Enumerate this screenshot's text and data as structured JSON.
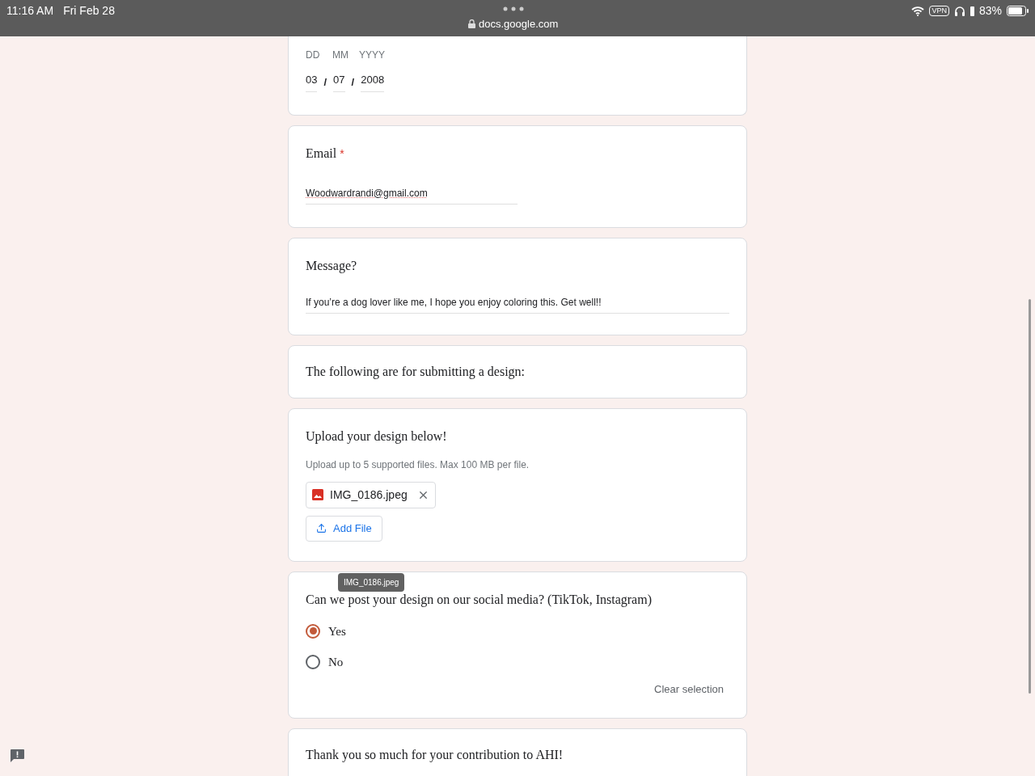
{
  "status_bar": {
    "time": "11:16 AM",
    "date": "Fri Feb 28",
    "url": "docs.google.com",
    "vpn": "VPN",
    "battery": "83%"
  },
  "cards": [
    {
      "kind": "date",
      "labels": [
        "DD",
        "MM",
        "YYYY"
      ],
      "values": [
        "03",
        "07",
        "2008"
      ],
      "separator": "/"
    },
    {
      "kind": "short_text",
      "title": "Email",
      "required_mark": "*",
      "value": "Woodwardrandi@gmail.com"
    },
    {
      "kind": "long_text",
      "title": "Message?",
      "value": "If you’re a dog lover like me, I hope you enjoy coloring this. Get well!!"
    },
    {
      "kind": "info",
      "title": "The following are for submitting a design:"
    },
    {
      "kind": "upload",
      "title": "Upload your design below!",
      "hint": "Upload up to 5 supported files. Max 100 MB per file.",
      "files": [
        "IMG_0186.jpeg"
      ],
      "add_label": "Add File"
    },
    {
      "kind": "radio",
      "tooltip": "IMG_0186.jpeg",
      "title": "Can we post your design on our social media? (TikTok, Instagram)",
      "options": [
        {
          "label": "Yes",
          "selected": true
        },
        {
          "label": "No",
          "selected": false
        }
      ],
      "clear_label": "Clear selection"
    },
    {
      "kind": "info",
      "title": "Thank you so much for your contribution to AHI!"
    }
  ]
}
